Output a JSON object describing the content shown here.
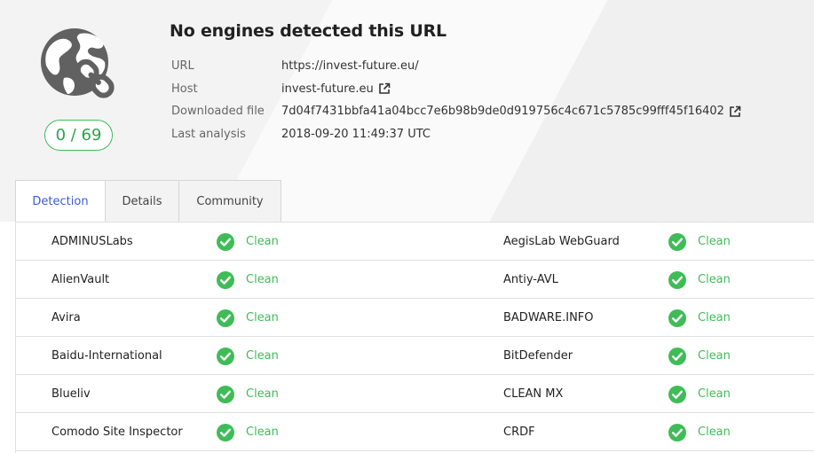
{
  "summary": {
    "score": "0 / 69",
    "title": "No engines detected this URL",
    "info": [
      {
        "label": "URL",
        "value": "https://invest-future.eu/",
        "link": false
      },
      {
        "label": "Host",
        "value": "invest-future.eu",
        "link": true
      },
      {
        "label": "Downloaded file",
        "value": "7d04f7431bbfa41a04bcc7e6b98b9de0d919756c4c671c5785c99fff45f16402",
        "link": true
      },
      {
        "label": "Last analysis",
        "value": "2018-09-20 11:49:37 UTC",
        "link": false
      }
    ]
  },
  "tabs": [
    {
      "label": "Detection",
      "active": true
    },
    {
      "label": "Details",
      "active": false
    },
    {
      "label": "Community",
      "active": false
    }
  ],
  "results": [
    {
      "left": {
        "engine": "ADMINUSLabs",
        "status": "Clean"
      },
      "right": {
        "engine": "AegisLab WebGuard",
        "status": "Clean"
      }
    },
    {
      "left": {
        "engine": "AlienVault",
        "status": "Clean"
      },
      "right": {
        "engine": "Antiy-AVL",
        "status": "Clean"
      }
    },
    {
      "left": {
        "engine": "Avira",
        "status": "Clean"
      },
      "right": {
        "engine": "BADWARE.INFO",
        "status": "Clean"
      }
    },
    {
      "left": {
        "engine": "Baidu-International",
        "status": "Clean"
      },
      "right": {
        "engine": "BitDefender",
        "status": "Clean"
      }
    },
    {
      "left": {
        "engine": "Blueliv",
        "status": "Clean"
      },
      "right": {
        "engine": "CLEAN MX",
        "status": "Clean"
      }
    },
    {
      "left": {
        "engine": "Comodo Site Inspector",
        "status": "Clean"
      },
      "right": {
        "engine": "CRDF",
        "status": "Clean"
      }
    }
  ],
  "colors": {
    "clean": "#3fbc57",
    "active_tab": "#3d5bd9",
    "globe": "#616161"
  },
  "icons": {
    "globe": "globe-link-icon",
    "external": "external-link-icon",
    "check": "check-circle-icon"
  }
}
